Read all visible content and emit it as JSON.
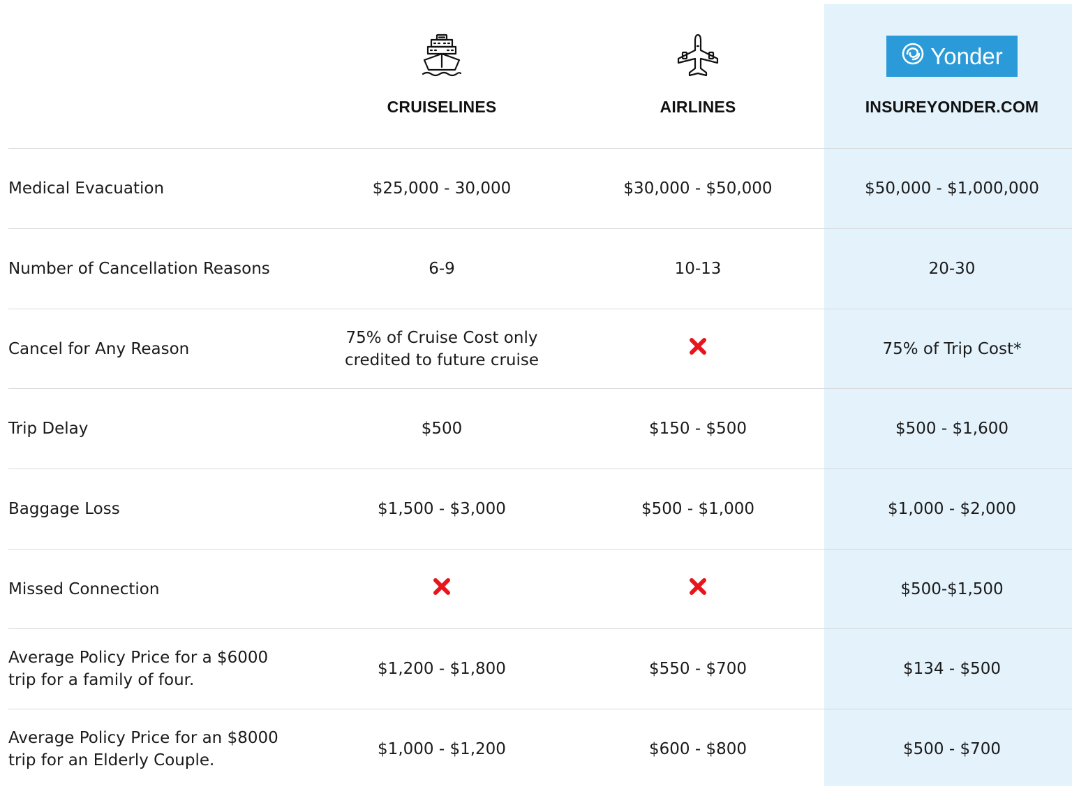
{
  "columns": {
    "cruiselines": {
      "label": "CRUISELINES",
      "icon": "ship-icon"
    },
    "airlines": {
      "label": "AIRLINES",
      "icon": "airplane-icon"
    },
    "yonder": {
      "label": "INSUREYONDER.COM",
      "logo_text": "Yonder",
      "icon": "yonder-swirl-icon"
    }
  },
  "colors": {
    "highlight_bg": "#e3f2fb",
    "logo_bg": "#2a9bd8",
    "x_mark": "#e8141b",
    "divider": "#d9d9d9"
  },
  "rows": [
    {
      "label": "Medical Evacuation",
      "cruiselines": "$25,000 - 30,000",
      "airlines": "$30,000 - $50,000",
      "yonder": "$50,000 - $1,000,000"
    },
    {
      "label": "Number of Cancellation Reasons",
      "cruiselines": "6-9",
      "airlines": "10-13",
      "yonder": "20-30"
    },
    {
      "label": "Cancel for Any Reason",
      "cruiselines": "75% of Cruise Cost only\ncredited to future cruise",
      "airlines": "not-covered",
      "yonder": "75% of Trip Cost*"
    },
    {
      "label": "Trip Delay",
      "cruiselines": "$500",
      "airlines": "$150 - $500",
      "yonder": "$500 - $1,600"
    },
    {
      "label": "Baggage Loss",
      "cruiselines": "$1,500 - $3,000",
      "airlines": "$500 - $1,000",
      "yonder": "$1,000 - $2,000"
    },
    {
      "label": "Missed Connection",
      "cruiselines": "not-covered",
      "airlines": "not-covered",
      "yonder": "$500-$1,500"
    },
    {
      "label": "Average Policy Price for a $6000\ntrip for a family of four.",
      "cruiselines": "$1,200 - $1,800",
      "airlines": "$550 - $700",
      "yonder": "$134 - $500"
    },
    {
      "label": "Average Policy Price for an $8000\ntrip for an Elderly Couple.",
      "cruiselines": "$1,000 - $1,200",
      "airlines": "$600 - $800",
      "yonder": "$500 - $700"
    }
  ]
}
